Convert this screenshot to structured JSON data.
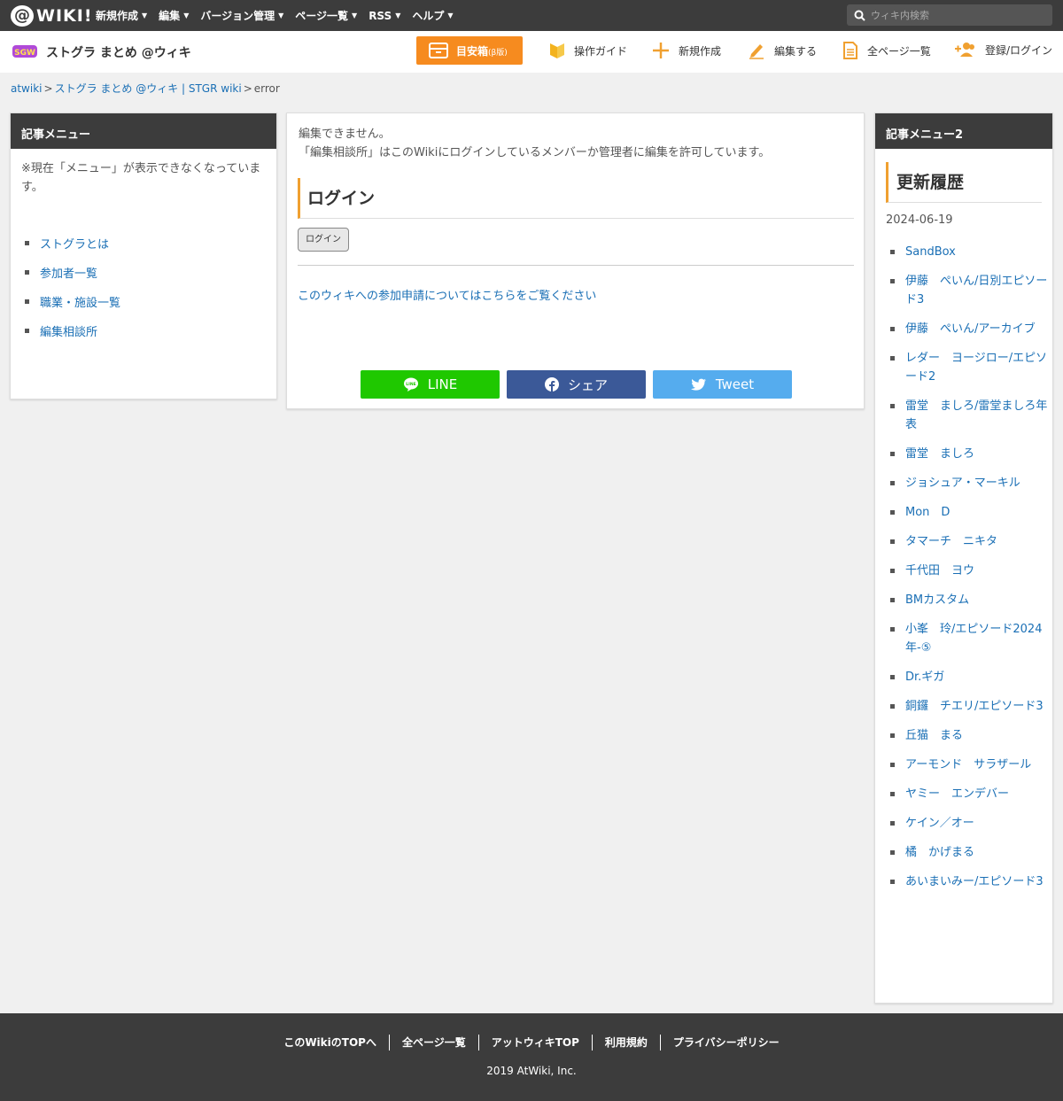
{
  "topbar": {
    "logo_text": "WIKI!",
    "nav": [
      "新規作成",
      "編集",
      "バージョン管理",
      "ページ一覧",
      "RSS",
      "ヘルプ"
    ],
    "search_placeholder": "ウィキ内検索"
  },
  "header": {
    "site_title": "ストグラ まとめ @ウィキ",
    "meyasu_label": "目安箱",
    "meyasu_sub": "β版",
    "nav": {
      "guide": "操作ガイド",
      "new": "新規作成",
      "edit": "編集する",
      "all_pages": "全ページ一覧",
      "login": "登録/ログイン"
    }
  },
  "breadcrumb": {
    "root": "atwiki",
    "wiki": "ストグラ まとめ @ウィキ | STGR wiki",
    "current": "error"
  },
  "left_menu": {
    "title": "記事メニュー",
    "note": "※現在「メニュー」が表示できなくなっています。",
    "items": [
      "ストグラとは",
      "参加者一覧",
      "職業・施設一覧",
      "編集相談所"
    ]
  },
  "main": {
    "line1": "編集できません。",
    "line2": "「編集相談所」はこのWikiにログインしているメンバーか管理者に編集を許可しています。",
    "heading": "ログイン",
    "login_button": "ログイン",
    "join_link": "このウィキへの参加申請についてはこちらをご覧ください",
    "share": {
      "line": "LINE",
      "facebook": "シェア",
      "twitter": "Tweet"
    }
  },
  "right_menu": {
    "title": "記事メニュー2",
    "recent_title": "更新履歴",
    "date": "2024-06-19",
    "items": [
      "SandBox",
      "伊藤　ぺいん/日別エピソード3",
      "伊藤　ぺいん/アーカイブ",
      "レダー　ヨージロー/エピソード2",
      "雷堂　ましろ/雷堂ましろ年表",
      "雷堂　ましろ",
      "ジョシュア・マーキル",
      "Mon　D",
      "タマーチ　ニキタ",
      "千代田　ヨウ",
      "BMカスタム",
      "小峯　玲/エピソード2024年-⑤",
      "Dr.ギガ",
      "銅鑼　チエリ/エピソード3",
      "丘猫　まる",
      "アーモンド　サラザール",
      "ヤミー　エンデバー",
      "ケイン／オー",
      "橘　かげまる",
      "あいまいみー/エピソード3"
    ]
  },
  "footer": {
    "links": [
      "このWikiのTOPへ",
      "全ページ一覧",
      "アットウィキTOP",
      "利用規約",
      "プライバシーポリシー"
    ],
    "copyright": "2019 AtWiki, Inc."
  },
  "colors": {
    "topbar_bg": "#3c3c3c",
    "accent_orange": "#f68b1f",
    "link_blue": "#1a6fb5",
    "line_green": "#1fc800",
    "facebook_blue": "#3b5998",
    "twitter_blue": "#55acee"
  }
}
